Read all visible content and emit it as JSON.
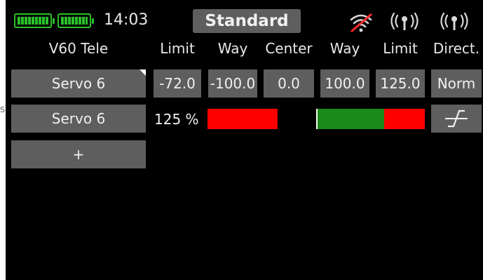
{
  "status": {
    "clock": "14:03",
    "battery_color": "#2bbf2b",
    "icons": [
      "battery-icon",
      "battery-icon",
      "signal-off-icon",
      "rc-transmitter-icon",
      "rc-transmitter-icon"
    ]
  },
  "mode": {
    "label": "Standard"
  },
  "header": {
    "model_name": "V60 Tele",
    "limit_left": "Limit",
    "way_left": "Way",
    "center": "Center",
    "way_right": "Way",
    "limit_right": "Limit",
    "direction": "Direct."
  },
  "rows": [
    {
      "servo": "Servo 6",
      "limit_left": "-72.0",
      "way_left": "-100.0",
      "center": "0.0",
      "way_right": "100.0",
      "limit_right": "125.0",
      "direction": "Norm"
    },
    {
      "servo": "Servo 6",
      "percent": "125 %"
    }
  ],
  "add_button": {
    "label": "+"
  },
  "left_edge_text": "S",
  "colors": {
    "bar_red": "#ff0000",
    "bar_green": "#1a8a1a",
    "cell_bg": "#5e5e5e"
  }
}
